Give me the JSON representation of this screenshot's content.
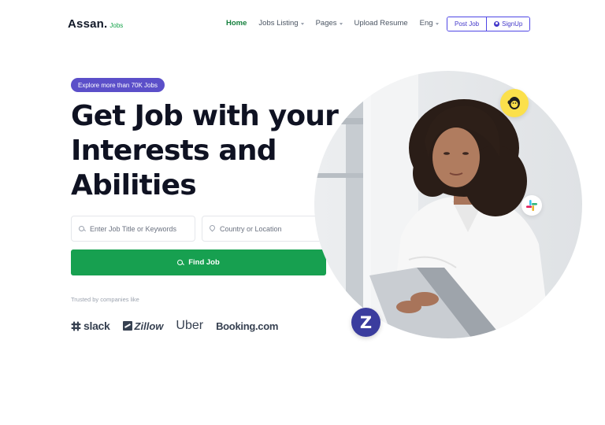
{
  "header": {
    "logo_main": "Assan.",
    "logo_sub": "Jobs",
    "nav": [
      {
        "label": "Home",
        "active": true,
        "dropdown": false
      },
      {
        "label": "Jobs Listing",
        "active": false,
        "dropdown": true
      },
      {
        "label": "Pages",
        "active": false,
        "dropdown": true
      },
      {
        "label": "Upload Resume",
        "active": false,
        "dropdown": false
      },
      {
        "label": "Eng",
        "active": false,
        "dropdown": true
      }
    ],
    "post_job_label": "Post Job",
    "signup_label": "SignUp"
  },
  "hero": {
    "badge": "Explore more than 70K Jobs",
    "title_lines": [
      "Get Job with your",
      "Interests and",
      "Abilities"
    ],
    "job_placeholder": "Enter Job Title or Keywords",
    "location_placeholder": "Country or Location",
    "find_label": "Find Job",
    "trusted_label": "Trusted by companies like",
    "brands": [
      "slack",
      "Zillow",
      "Uber",
      "Booking.com"
    ],
    "z_badge": "Z"
  },
  "colors": {
    "accent_green": "#17a050",
    "brand_purple": "#5b4fc9",
    "nav_active": "#15803d",
    "mailchimp_yellow": "#fbe04b",
    "z_blue": "#3b3d9e"
  },
  "icons": [
    "search-icon",
    "location-pin-icon",
    "user-icon",
    "chevron-down-icon",
    "mailchimp-icon",
    "slack-icon"
  ]
}
